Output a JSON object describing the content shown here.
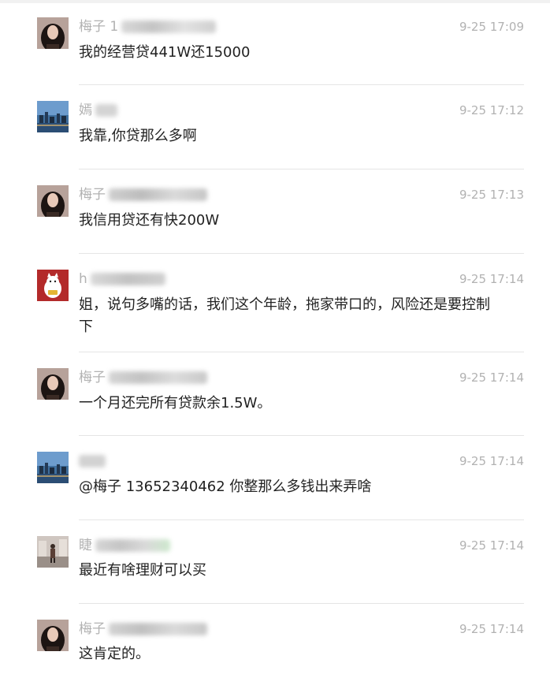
{
  "messages": [
    {
      "author": "梅子 1",
      "time": "9-25 17:09",
      "text": "我的经营贷441W还15000"
    },
    {
      "author": "嫣",
      "time": "9-25 17:12",
      "text": "我靠,你贷那么多啊"
    },
    {
      "author": "梅子",
      "time": "9-25 17:13",
      "text": "我信用贷还有快200W"
    },
    {
      "author": "h",
      "time": "9-25 17:14",
      "text": "姐，说句多嘴的话，我们这个年龄，拖家带口的，风险还是要控制下"
    },
    {
      "author": "梅子",
      "time": "9-25 17:14",
      "text": "一个月还完所有贷款余1.5W。"
    },
    {
      "author": "",
      "time": "9-25 17:14",
      "text": "@梅子 13652340462 你整那么多钱出来弄啥"
    },
    {
      "author": "睫",
      "time": "9-25 17:14",
      "text": "最近有啥理财可以买"
    },
    {
      "author": "梅子",
      "time": "9-25 17:14",
      "text": "这肯定的。"
    }
  ],
  "avatars": [
    "woman-portrait",
    "city-night",
    "woman-portrait",
    "lucky-cat",
    "woman-portrait",
    "city-night",
    "person-street",
    "woman-portrait"
  ]
}
